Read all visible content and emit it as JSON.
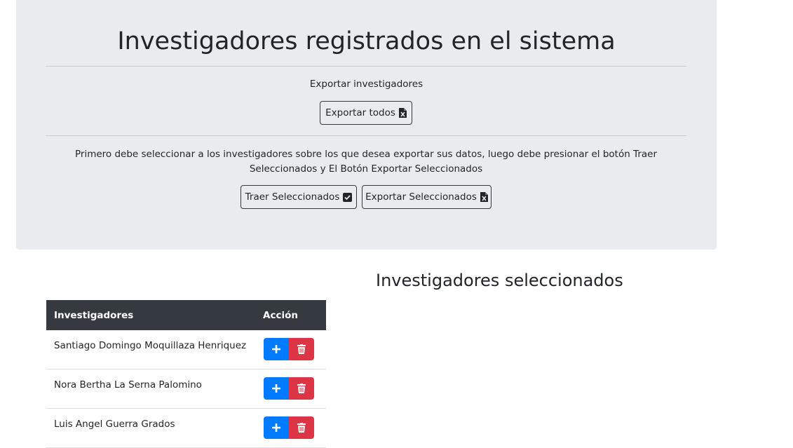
{
  "header": {
    "title": "Investigadores registrados en el sistema",
    "export_label": "Exportar investigadores",
    "export_all_button": "Exportar todos",
    "instructions": "Primero debe seleccionar a los investigadores sobre los que desea exportar sus datos, luego debe presionar el botón Traer Seleccionados y El Botón Exportar Seleccionados",
    "fetch_selected_button": "Traer Seleccionados",
    "export_selected_button": "Exportar Seleccionados"
  },
  "selected_section": {
    "title": "Investigadores seleccionados"
  },
  "table": {
    "headers": [
      "Investigadores",
      "Acción"
    ],
    "rows": [
      {
        "name": "Santiago Domingo Moquillaza Henriquez"
      },
      {
        "name": "Nora Bertha La Serna Palomino"
      },
      {
        "name": "Luis Angel Guerra Grados"
      }
    ]
  },
  "icons": {
    "export": "file-excel-icon",
    "fetch": "check-square-icon",
    "add": "plus-icon",
    "delete": "trash-icon"
  },
  "colors": {
    "jumbotron_bg": "#e9ecef",
    "table_header_bg": "#343a40",
    "add_button": "#007bff",
    "delete_button": "#dc3545"
  }
}
